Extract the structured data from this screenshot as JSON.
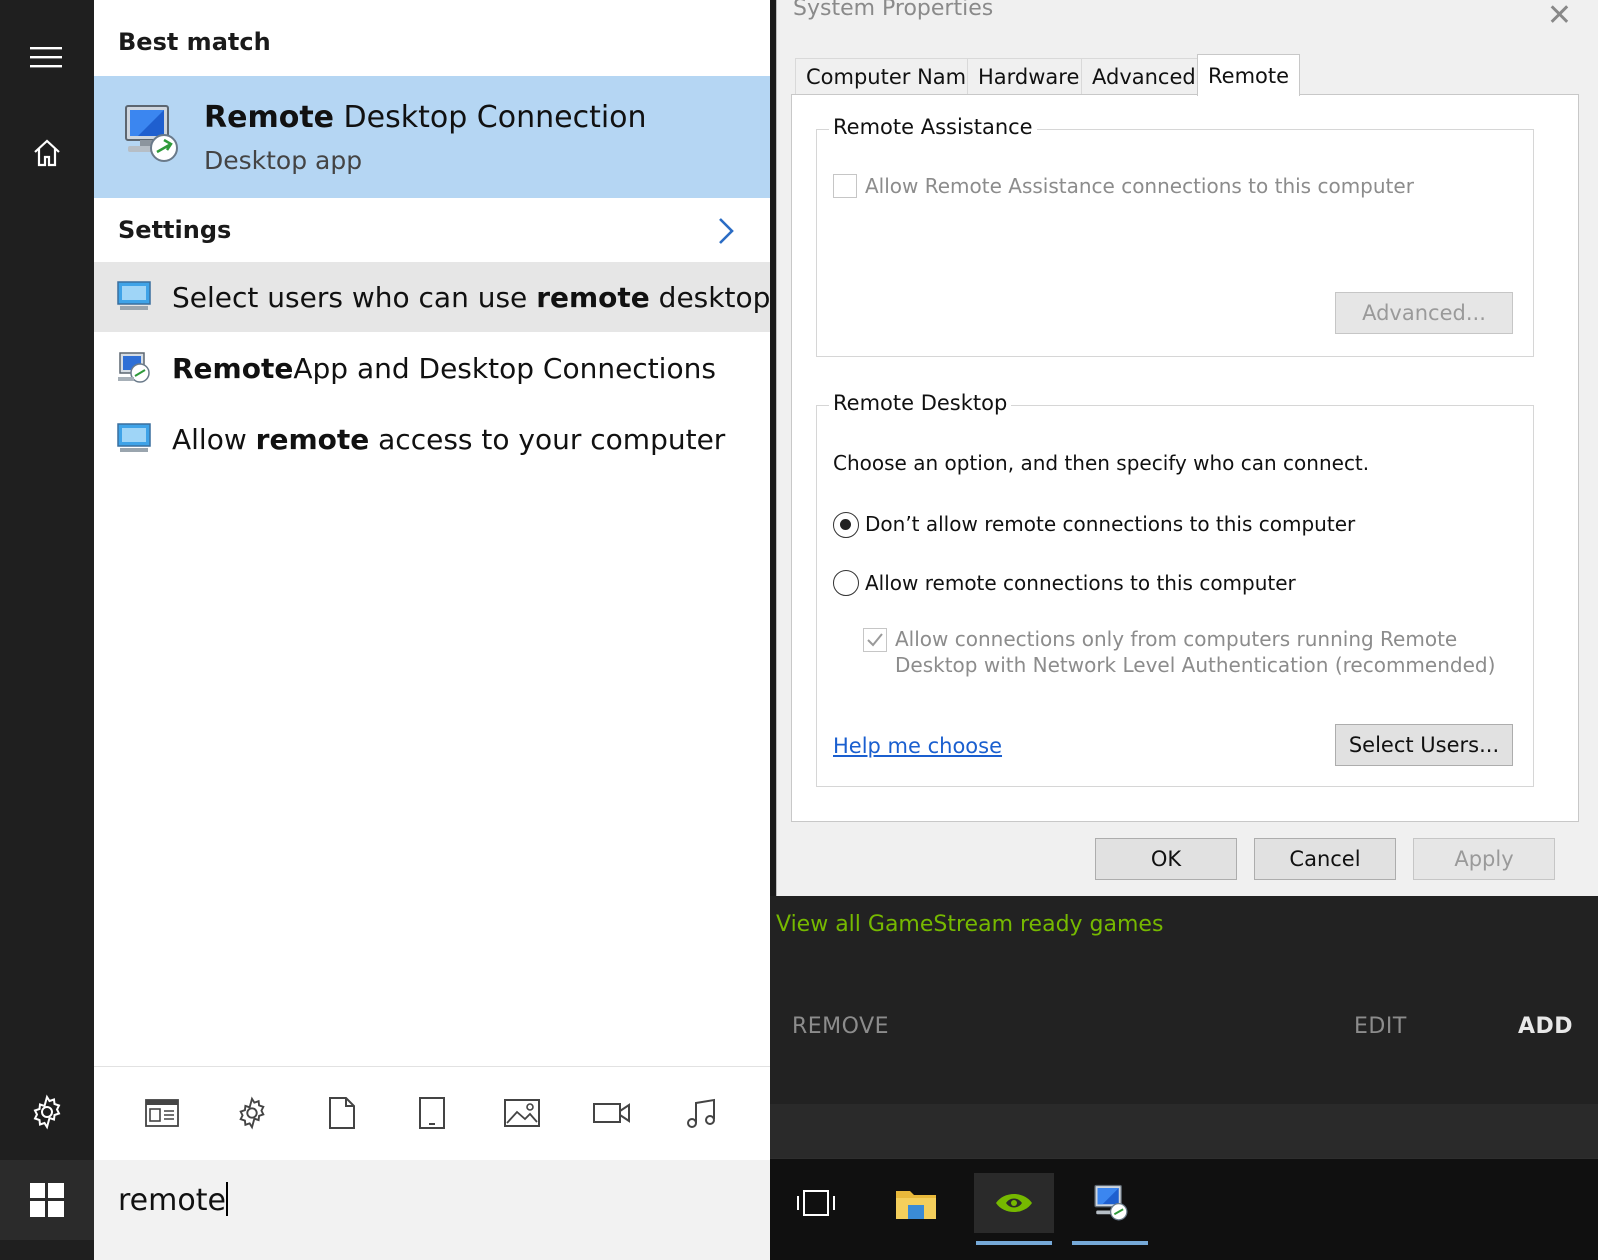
{
  "search_panel": {
    "best_match_header": "Best match",
    "best_match": {
      "title_bold": "Remote",
      "title_rest": " Desktop Connection",
      "subtitle": "Desktop app"
    },
    "settings_header": "Settings",
    "results": [
      {
        "pre": "Select users who can use ",
        "bold": "remote",
        "post": " desktop"
      },
      {
        "pre": "",
        "bold": "Remote",
        "post": "App and Desktop Connections"
      },
      {
        "pre": "Allow ",
        "bold": "remote",
        "post": " access to your computer"
      }
    ],
    "filter_icons": [
      "apps-icon",
      "settings-icon",
      "documents-icon",
      "tablet-icon",
      "photos-icon",
      "videos-icon",
      "music-icon"
    ],
    "search_value": "remote"
  },
  "dialog": {
    "title": "System Properties",
    "close_glyph": "✕",
    "tabs": [
      "Computer Name",
      "Hardware",
      "Advanced",
      "Remote"
    ],
    "active_tab": "Remote",
    "remote_assistance": {
      "label": "Remote Assistance",
      "checkbox_label": "Allow Remote Assistance connections to this computer",
      "checked": false,
      "advanced_button": "Advanced..."
    },
    "remote_desktop": {
      "label": "Remote Desktop",
      "instruction": "Choose an option, and then specify who can connect.",
      "option_dont_allow": "Don’t allow remote connections to this computer",
      "option_allow": "Allow remote connections to this computer",
      "selected_option": "dont_allow",
      "nla_line1": "Allow connections only from computers running Remote",
      "nla_line2": "Desktop with Network Level Authentication (recommended)",
      "nla_checked": true,
      "help_link": "Help me choose",
      "select_users_button": "Select Users..."
    },
    "buttons": {
      "ok": "OK",
      "cancel": "Cancel",
      "apply": "Apply"
    }
  },
  "gamestream": {
    "link": "View all GameStream ready games",
    "remove": "REMOVE",
    "edit": "EDIT",
    "add": "ADD",
    "accent_color": "#76b900"
  },
  "taskbar": {
    "items": [
      "task-view-icon",
      "file-explorer-icon",
      "nvidia-icon",
      "remote-desktop-icon"
    ]
  }
}
